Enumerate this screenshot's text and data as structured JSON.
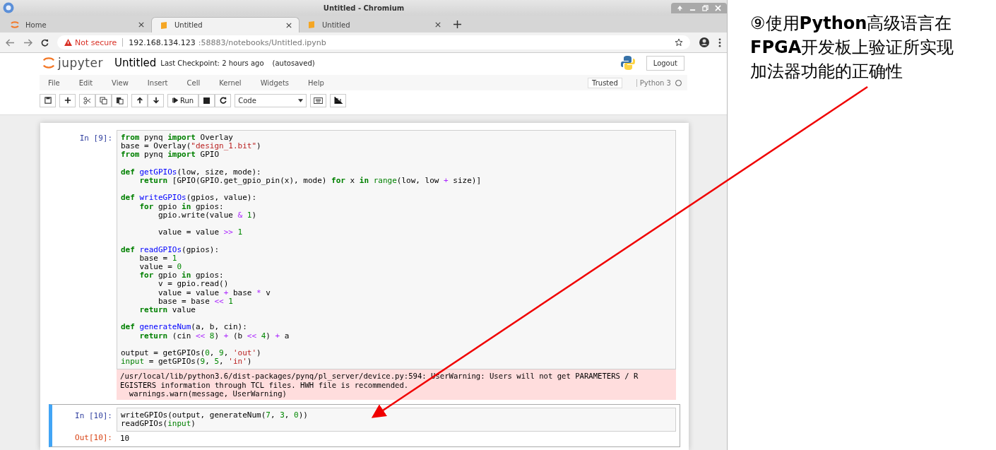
{
  "window": {
    "title": "Untitled - Chromium"
  },
  "tabs": [
    {
      "label": "Home",
      "selected": false,
      "kind": "home"
    },
    {
      "label": "Untitled",
      "selected": true,
      "kind": "notebook"
    },
    {
      "label": "Untitled",
      "selected": false,
      "kind": "notebook"
    }
  ],
  "address_bar": {
    "security": "Not secure",
    "host": "192.168.134.123",
    "path": ":58883/notebooks/Untitled.ipynb"
  },
  "header": {
    "logo": "jupyter",
    "notebook_name": "Untitled",
    "checkpoint": "Last Checkpoint: 2 hours ago",
    "autosave": "(autosaved)",
    "logout": "Logout"
  },
  "menu": [
    "File",
    "Edit",
    "View",
    "Insert",
    "Cell",
    "Kernel",
    "Widgets",
    "Help"
  ],
  "trusted": "Trusted",
  "kernel": "Python 3",
  "toolbar": {
    "run": "Run",
    "cell_type": "Code"
  },
  "cells": [
    {
      "prompt": "In [9]:",
      "selected": false,
      "blocks": [
        [
          [
            {
              "text": "from",
              "kind": "keyword"
            },
            {
              "text": " pynq "
            },
            {
              "text": "import",
              "kind": "keyword"
            },
            {
              "text": " Overlay"
            }
          ],
          [
            {
              "text": "base = Overlay("
            },
            {
              "text": "\"design_1.bit\"",
              "kind": "string"
            },
            {
              "text": ")"
            }
          ],
          [
            {
              "text": "from",
              "kind": "keyword"
            },
            {
              "text": " pynq "
            },
            {
              "text": "import",
              "kind": "keyword"
            },
            {
              "text": " GPIO"
            }
          ]
        ],
        [
          [
            {
              "text": "def ",
              "kind": "keyword"
            },
            {
              "text": "getGPIOs",
              "kind": "function"
            },
            {
              "text": "(low, size, mode):"
            }
          ],
          [
            {
              "text": "    return",
              "kind": "keyword"
            },
            {
              "text": " [GPIO(GPIO.get_gpio_pin(x), mode) "
            },
            {
              "text": "for",
              "kind": "keyword"
            },
            {
              "text": " x "
            },
            {
              "text": "in ",
              "kind": "keyword"
            },
            {
              "text": "range",
              "kind": "builtin"
            },
            {
              "text": "(low, low "
            },
            {
              "text": "+",
              "kind": "operator"
            },
            {
              "text": " size)]"
            }
          ]
        ],
        [
          [
            {
              "text": "def ",
              "kind": "keyword"
            },
            {
              "text": "writeGPIOs",
              "kind": "function"
            },
            {
              "text": "(gpios, value):"
            }
          ],
          [
            {
              "text": "    for",
              "kind": "keyword"
            },
            {
              "text": " gpio "
            },
            {
              "text": "in",
              "kind": "keyword"
            },
            {
              "text": " gpios:"
            }
          ],
          [
            {
              "text": "        gpio.write(value "
            },
            {
              "text": "& ",
              "kind": "operator"
            },
            {
              "text": "1",
              "kind": "number"
            },
            {
              "text": ")"
            }
          ]
        ],
        [
          [
            {
              "text": "        value = value "
            },
            {
              "text": ">> ",
              "kind": "operator"
            },
            {
              "text": "1",
              "kind": "number"
            }
          ]
        ],
        [
          [
            {
              "text": "def ",
              "kind": "keyword"
            },
            {
              "text": "readGPIOs",
              "kind": "function"
            },
            {
              "text": "(gpios):"
            }
          ],
          [
            {
              "text": "    base = "
            },
            {
              "text": "1",
              "kind": "number"
            }
          ],
          [
            {
              "text": "    value = "
            },
            {
              "text": "0",
              "kind": "number"
            }
          ],
          [
            {
              "text": "    for",
              "kind": "keyword"
            },
            {
              "text": " gpio "
            },
            {
              "text": "in",
              "kind": "keyword"
            },
            {
              "text": " gpios:"
            }
          ],
          [
            {
              "text": "        v = gpio.read()"
            }
          ],
          [
            {
              "text": "        value = value "
            },
            {
              "text": "+",
              "kind": "operator"
            },
            {
              "text": " base "
            },
            {
              "text": "*",
              "kind": "operator"
            },
            {
              "text": " v"
            }
          ],
          [
            {
              "text": "        base = base "
            },
            {
              "text": "<< ",
              "kind": "operator"
            },
            {
              "text": "1",
              "kind": "number"
            }
          ],
          [
            {
              "text": "    return",
              "kind": "keyword"
            },
            {
              "text": " value"
            }
          ]
        ],
        [
          [
            {
              "text": "def ",
              "kind": "keyword"
            },
            {
              "text": "generateNum",
              "kind": "function"
            },
            {
              "text": "(a, b, cin):"
            }
          ],
          [
            {
              "text": "    return",
              "kind": "keyword"
            },
            {
              "text": " (cin "
            },
            {
              "text": "<< ",
              "kind": "operator"
            },
            {
              "text": "8",
              "kind": "number"
            },
            {
              "text": ") "
            },
            {
              "text": "+",
              "kind": "operator"
            },
            {
              "text": " (b "
            },
            {
              "text": "<< ",
              "kind": "operator"
            },
            {
              "text": "4",
              "kind": "number"
            },
            {
              "text": ") "
            },
            {
              "text": "+",
              "kind": "operator"
            },
            {
              "text": " a"
            }
          ]
        ],
        [
          [
            {
              "text": "output = getGPIOs("
            },
            {
              "text": "0",
              "kind": "number"
            },
            {
              "text": ", "
            },
            {
              "text": "9",
              "kind": "number"
            },
            {
              "text": ", "
            },
            {
              "text": "'out'",
              "kind": "string"
            },
            {
              "text": ")"
            }
          ],
          [
            {
              "text": "input",
              "kind": "builtin"
            },
            {
              "text": " = getGPIOs("
            },
            {
              "text": "9",
              "kind": "number"
            },
            {
              "text": ", "
            },
            {
              "text": "5",
              "kind": "number"
            },
            {
              "text": ", "
            },
            {
              "text": "'in'",
              "kind": "string"
            },
            {
              "text": ")"
            }
          ]
        ]
      ],
      "warning": "/usr/local/lib/python3.6/dist-packages/pynq/pl_server/device.py:594: UserWarning: Users will not get PARAMETERS / R\nEGISTERS information through TCL files. HWH file is recommended.\n  warnings.warn(message, UserWarning)"
    },
    {
      "prompt": "In [10]:",
      "selected": true,
      "blocks": [
        [
          [
            {
              "text": "writeGPIOs(output, generateNum("
            },
            {
              "text": "7",
              "kind": "number"
            },
            {
              "text": ", "
            },
            {
              "text": "3",
              "kind": "number"
            },
            {
              "text": ", "
            },
            {
              "text": "0",
              "kind": "number"
            },
            {
              "text": "))"
            }
          ],
          [
            {
              "text": "readGPIOs("
            },
            {
              "text": "input",
              "kind": "builtin"
            },
            {
              "text": ")"
            }
          ]
        ]
      ],
      "out_prompt": "Out[10]:",
      "output": "10"
    }
  ],
  "annotation": "⑨使用**Python**高级语言在**FPGA**开发板上验证所实现加法器功能的正确性"
}
